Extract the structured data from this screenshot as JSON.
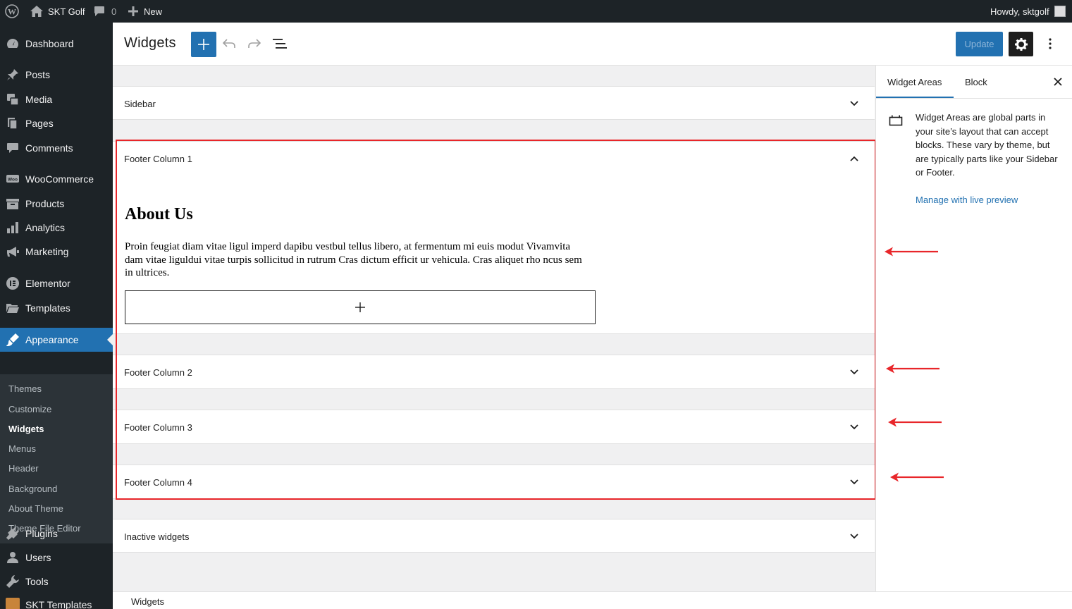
{
  "admin_bar": {
    "site_name": "SKT Golf",
    "comments_count": "0",
    "new_label": "New",
    "howdy": "Howdy, sktgolf"
  },
  "sidebar": {
    "menu": [
      {
        "label": "Dashboard",
        "icon": "dashboard-icon"
      },
      {
        "label": "Posts",
        "icon": "pin-icon"
      },
      {
        "label": "Media",
        "icon": "media-icon"
      },
      {
        "label": "Pages",
        "icon": "pages-icon"
      },
      {
        "label": "Comments",
        "icon": "comment-icon"
      },
      {
        "label": "WooCommerce",
        "icon": "woo-icon"
      },
      {
        "label": "Products",
        "icon": "archive-icon"
      },
      {
        "label": "Analytics",
        "icon": "bar-chart-icon"
      },
      {
        "label": "Marketing",
        "icon": "megaphone-icon"
      },
      {
        "label": "Elementor",
        "icon": "elementor-icon"
      },
      {
        "label": "Templates",
        "icon": "folder-icon"
      },
      {
        "label": "Appearance",
        "icon": "brush-icon"
      },
      {
        "label": "Plugins",
        "icon": "plug-icon"
      },
      {
        "label": "Users",
        "icon": "user-icon"
      },
      {
        "label": "Tools",
        "icon": "wrench-icon"
      },
      {
        "label": "SKT Templates",
        "icon": "skt-icon"
      }
    ],
    "submenu": [
      "Themes",
      "Customize",
      "Widgets",
      "Menus",
      "Header",
      "Background",
      "About Theme",
      "Theme File Editor"
    ]
  },
  "header": {
    "title": "Widgets",
    "update_label": "Update"
  },
  "areas": {
    "sidebar": "Sidebar",
    "footer1": "Footer Column 1",
    "footer2": "Footer Column 2",
    "footer3": "Footer Column 3",
    "footer4": "Footer Column 4",
    "inactive": "Inactive widgets"
  },
  "widget": {
    "heading": "About Us",
    "text": "Proin feugiat diam vitae ligul imperd dapibu vestbul tellus libero, at fermentum mi euis modut Vivamvita dam vitae liguldui vitae turpis sollicitud in rutrum Cras dictum efficit ur vehicula. Cras aliquet rho ncus sem in ultrices."
  },
  "inspector": {
    "tab_widget_areas": "Widget Areas",
    "tab_block": "Block",
    "description": "Widget Areas are global parts in your site’s layout that can accept blocks. These vary by theme, but are typically parts like your Sidebar or Footer.",
    "manage_link": "Manage with live preview"
  },
  "footer": {
    "breadcrumb": "Widgets"
  },
  "colors": {
    "accent": "#2271b1",
    "admin_dark": "#1d2327",
    "highlight_red": "#e8262a"
  }
}
